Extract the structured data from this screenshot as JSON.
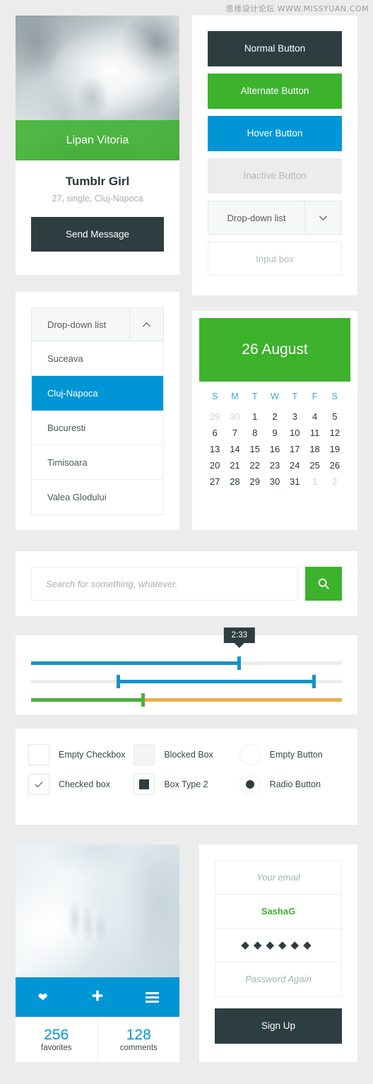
{
  "watermark": "思缘设计论坛 WWW.MISSYUAN.COM",
  "colors": {
    "green": "#3cb22d",
    "blue": "#0096d6",
    "dark": "#2e3d40",
    "slider_blue": "#1593c6",
    "slider_green": "#4caf3c",
    "slider_orange": "#f0ad4e",
    "calendar_dow_blue": "#35aadc",
    "inactive_gray": "#ececec",
    "page_bg": "#ececec"
  },
  "profile": {
    "name_banner": "Lipan Vitoria",
    "title": "Tumblr Girl",
    "subtitle": "27, single, Cluj-Napoca",
    "button_label": "Send Message"
  },
  "buttons": {
    "normal": "Normal Button",
    "alternate": "Alternate Button",
    "hover": "Hover Button",
    "inactive": "Inactive Button",
    "dropdown_label": "Drop-down list",
    "input_placeholder": "Input box",
    "input_value": ""
  },
  "dropdown_open": {
    "label": "Drop-down list",
    "items": [
      {
        "label": "Suceava",
        "selected": false
      },
      {
        "label": "Cluj-Napoca",
        "selected": true
      },
      {
        "label": "Bucuresti",
        "selected": false
      },
      {
        "label": "Timisoara",
        "selected": false
      },
      {
        "label": "Valea Glodului",
        "selected": false
      }
    ]
  },
  "calendar": {
    "header": "26 August",
    "weekdays": [
      "S",
      "M",
      "T",
      "W",
      "T",
      "F",
      "S"
    ],
    "days": [
      {
        "d": "29",
        "muted": true
      },
      {
        "d": "30",
        "muted": true
      },
      {
        "d": "1",
        "muted": false
      },
      {
        "d": "2",
        "muted": false
      },
      {
        "d": "3",
        "muted": false
      },
      {
        "d": "4",
        "muted": false
      },
      {
        "d": "5",
        "muted": false
      },
      {
        "d": "6",
        "muted": false
      },
      {
        "d": "7",
        "muted": false
      },
      {
        "d": "8",
        "muted": false
      },
      {
        "d": "9",
        "muted": false
      },
      {
        "d": "10",
        "muted": false
      },
      {
        "d": "11",
        "muted": false
      },
      {
        "d": "12",
        "muted": false
      },
      {
        "d": "13",
        "muted": false
      },
      {
        "d": "14",
        "muted": false
      },
      {
        "d": "15",
        "muted": false
      },
      {
        "d": "16",
        "muted": false
      },
      {
        "d": "17",
        "muted": false
      },
      {
        "d": "18",
        "muted": false
      },
      {
        "d": "19",
        "muted": false
      },
      {
        "d": "20",
        "muted": false
      },
      {
        "d": "21",
        "muted": false
      },
      {
        "d": "22",
        "muted": false
      },
      {
        "d": "23",
        "muted": false
      },
      {
        "d": "24",
        "muted": false
      },
      {
        "d": "25",
        "muted": false
      },
      {
        "d": "26",
        "muted": false
      },
      {
        "d": "27",
        "muted": false
      },
      {
        "d": "28",
        "muted": false
      },
      {
        "d": "29",
        "muted": false
      },
      {
        "d": "30",
        "muted": false
      },
      {
        "d": "31",
        "muted": false
      },
      {
        "d": "1",
        "muted": true
      },
      {
        "d": "2",
        "muted": true
      }
    ]
  },
  "search": {
    "placeholder": "Search for something, whatever.",
    "value": "",
    "icon": "search-icon"
  },
  "sliders": [
    {
      "name": "single-handle",
      "fill_percent": 67,
      "handle_percent": 67,
      "tooltip": "2:33",
      "color": "#1593c6"
    },
    {
      "name": "range",
      "start_percent": 28,
      "end_percent": 91,
      "color": "#1593c6"
    },
    {
      "name": "progress",
      "fill_percent": 36,
      "color": "#4caf3c",
      "remainder_color": "#f0ad4e"
    }
  ],
  "checkboxes": [
    {
      "label": "Empty Checkbox",
      "type": "empty-box"
    },
    {
      "label": "Blocked Box",
      "type": "blocked-box"
    },
    {
      "label": "Empty Button",
      "type": "empty-radio"
    },
    {
      "label": "Checked box",
      "type": "checked-box"
    },
    {
      "label": "Box Type 2",
      "type": "filled-box"
    },
    {
      "label": "Radio Button",
      "type": "filled-radio"
    }
  ],
  "photo_stats": {
    "icons": [
      "heart-icon",
      "plus-icon",
      "menu-icon"
    ],
    "stats": [
      {
        "value": "256",
        "label": "favorites"
      },
      {
        "value": "128",
        "label": "comments"
      }
    ]
  },
  "signup": {
    "email_placeholder": "Your email",
    "email_value": "",
    "username_value": "SashaG",
    "password_value": "◆◆◆◆◆◆",
    "password_again_placeholder": "Password Again",
    "password_again_value": "",
    "button_label": "Sign Up"
  }
}
